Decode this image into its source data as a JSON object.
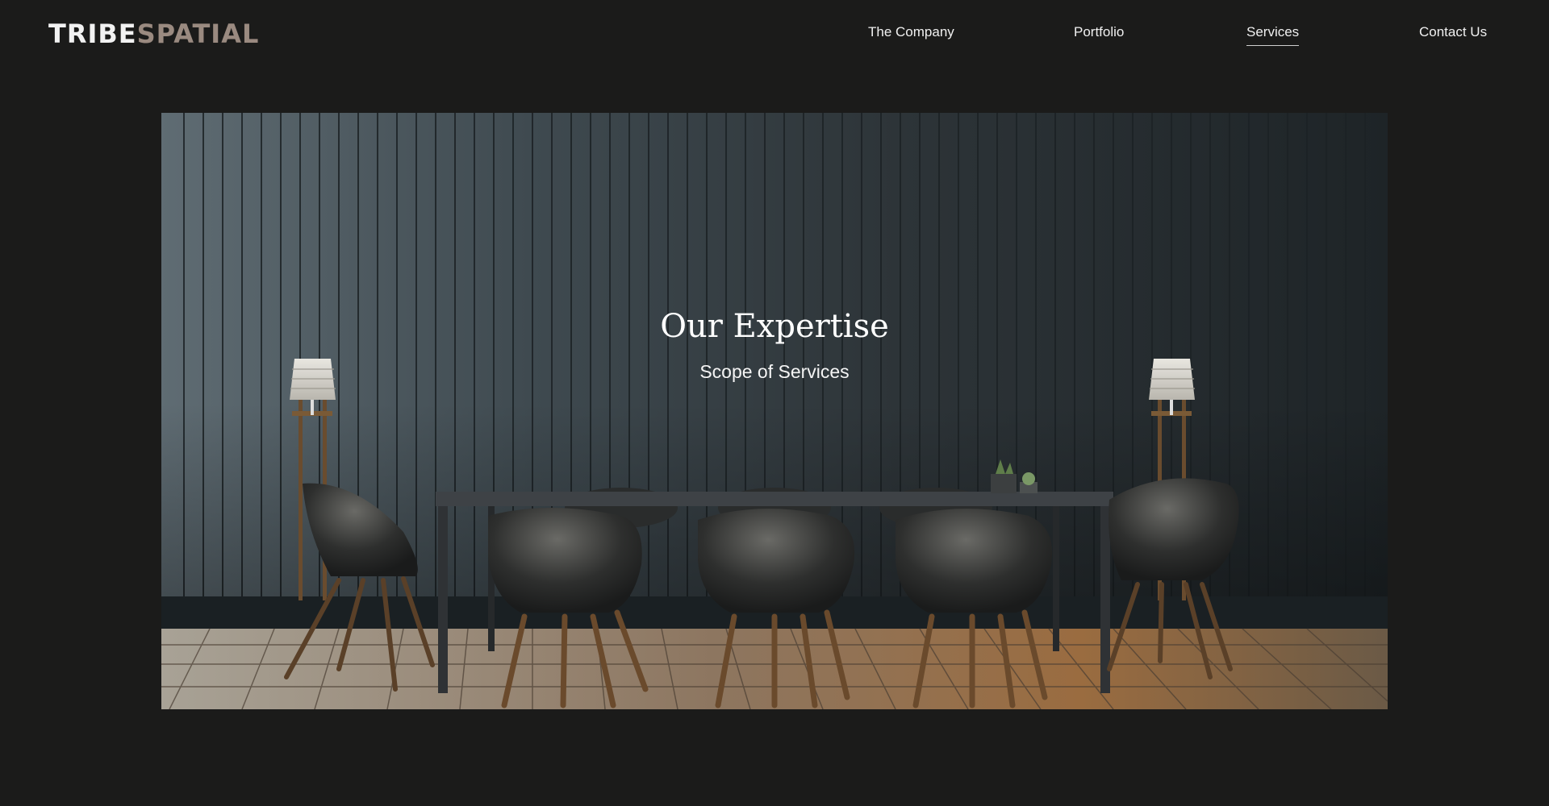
{
  "brand": {
    "part1": "TRIBE",
    "part2": "SPATIAL"
  },
  "nav": {
    "items": [
      {
        "label": "The Company",
        "active": false
      },
      {
        "label": "Portfolio",
        "active": false
      },
      {
        "label": "Services",
        "active": true
      },
      {
        "label": "Contact Us",
        "active": false
      }
    ]
  },
  "hero": {
    "title": "Our Expertise",
    "subtitle": "Scope of Services"
  },
  "colors": {
    "background": "#1b1b1a",
    "brand_accent": "#9a8a80",
    "text": "#ffffff"
  }
}
